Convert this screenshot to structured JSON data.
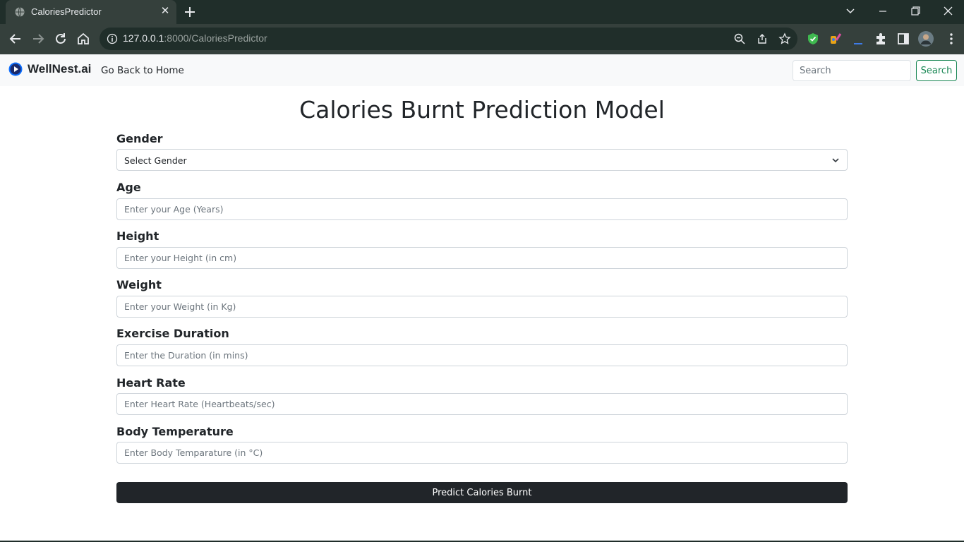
{
  "browser": {
    "tab_title": "CaloriesPredictor",
    "url_host": "127.0.0.1",
    "url_rest": ":8000/CaloriesPredictor",
    "icons": {
      "back": "arrow-left-icon",
      "forward": "arrow-right-icon",
      "reload": "reload-icon",
      "home": "home-icon",
      "info": "info-icon",
      "zoom": "zoom-icon",
      "share": "share-icon",
      "bookmark": "star-icon",
      "extensions": [
        "shield-extension-icon",
        "brush-extension-icon",
        "underline-extension-icon",
        "puzzle-icon",
        "side-panel-icon",
        "profile-avatar",
        "menu-dots-icon"
      ]
    }
  },
  "navbar": {
    "brand": "WellNest.ai",
    "home_link": "Go Back to Home",
    "search_placeholder": "Search",
    "search_button": "Search"
  },
  "main": {
    "title": "Calories Burnt Prediction Model",
    "gender": {
      "label": "Gender",
      "selected": "Select Gender"
    },
    "age": {
      "label": "Age",
      "placeholder": "Enter your Age (Years)"
    },
    "height": {
      "label": "Height",
      "placeholder": "Enter your Height (in cm)"
    },
    "weight": {
      "label": "Weight",
      "placeholder": "Enter your Weight (in Kg)"
    },
    "duration": {
      "label": "Exercise Duration",
      "placeholder": "Enter the Duration (in mins)"
    },
    "heart_rate": {
      "label": "Heart Rate",
      "placeholder": "Enter Heart Rate (Heartbeats/sec)"
    },
    "body_temp": {
      "label": "Body Temperature",
      "placeholder": "Enter Body Temparature (in °C)"
    },
    "submit": "Predict Calories Burnt"
  },
  "colors": {
    "chrome_dark": "#202e2a",
    "chrome_toolbar": "#35403c",
    "navbar_bg": "#f8f9fa",
    "success_green": "#198754",
    "dark_button": "#212529",
    "brand_blue": "#0d6efd"
  }
}
